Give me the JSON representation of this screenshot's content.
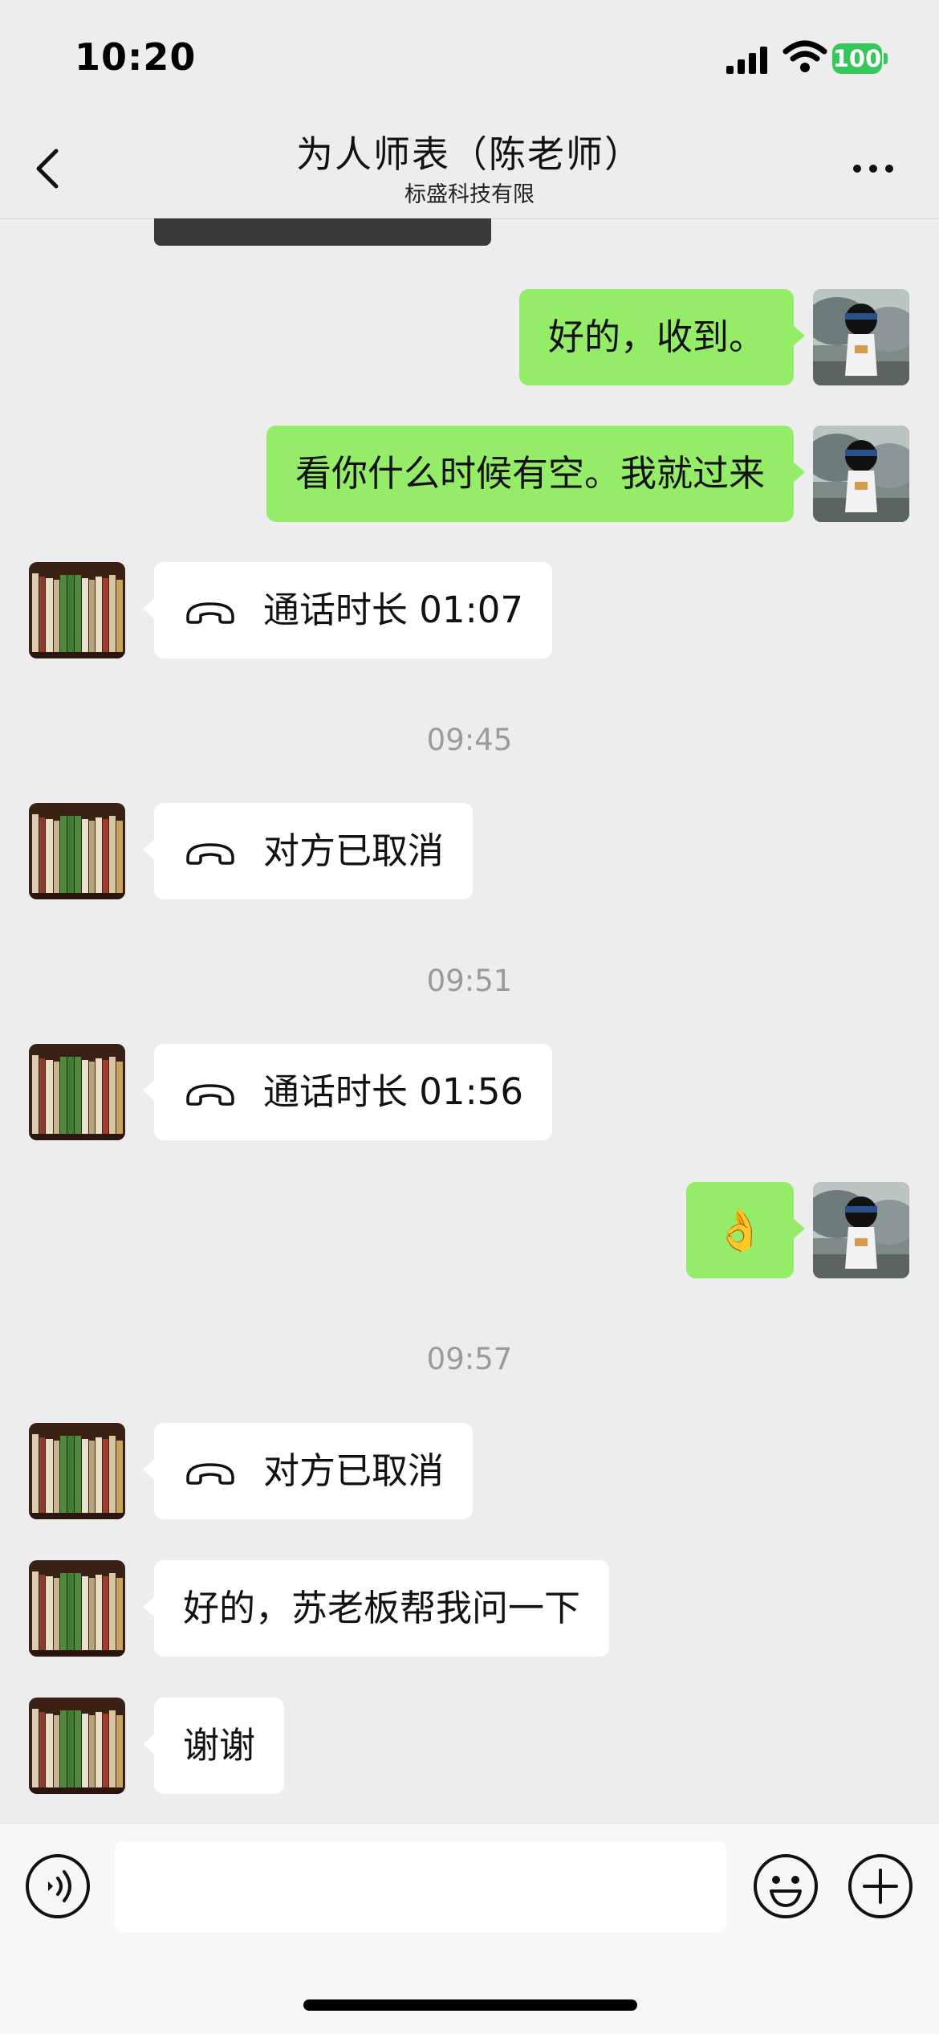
{
  "status_bar": {
    "time": "10:20",
    "battery": "100"
  },
  "header": {
    "title": "为人师表（陈老师）",
    "subtitle": "标盛科技有限"
  },
  "messages": [
    {
      "side": "me",
      "text": "好的，收到。"
    },
    {
      "side": "me",
      "text": "看你什么时候有空。我就过来"
    },
    {
      "side": "them",
      "type": "call",
      "text": "通话时长 01:07"
    },
    {
      "type": "time",
      "text": "09:45"
    },
    {
      "side": "them",
      "type": "call",
      "text": "对方已取消"
    },
    {
      "type": "time",
      "text": "09:51"
    },
    {
      "side": "them",
      "type": "call",
      "text": "通话时长 01:56"
    },
    {
      "side": "me",
      "text": "👌"
    },
    {
      "type": "time",
      "text": "09:57"
    },
    {
      "side": "them",
      "type": "call",
      "text": "对方已取消"
    },
    {
      "side": "them",
      "text": "好的，苏老板帮我问一下"
    },
    {
      "side": "them",
      "text": "谢谢"
    }
  ],
  "colors": {
    "sent_bubble": "#95ec69",
    "received_bubble": "#ffffff",
    "background": "#ededed",
    "battery": "#34c759"
  },
  "icons": [
    "back-icon",
    "more-icon",
    "phone-call-icon",
    "voice-icon",
    "emoji-icon",
    "plus-icon"
  ]
}
